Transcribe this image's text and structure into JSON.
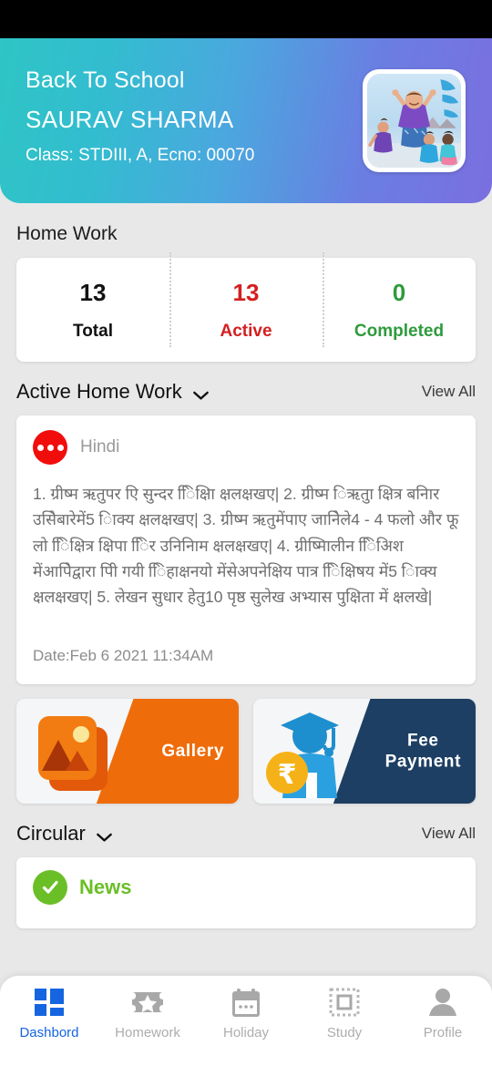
{
  "header": {
    "greeting": "Back To School",
    "student_name": "SAURAV  SHARMA",
    "class_info": "Class: STDIII, A, Ecno: 00070",
    "avatar_alt": "student-photo",
    "gradient_start": "#2ec5c5",
    "gradient_end": "#7a6fe0"
  },
  "homework_section": {
    "title": "Home Work",
    "stats": [
      {
        "value": "13",
        "label": "Total",
        "color": "#111111"
      },
      {
        "value": "13",
        "label": "Active",
        "color": "#d32020"
      },
      {
        "value": "0",
        "label": "Completed",
        "color": "#2e9b3c"
      }
    ]
  },
  "active_homework": {
    "title": "Active Home Work",
    "view_all": "View All",
    "card": {
      "subject": "Hindi",
      "body": "1. ग्रीष्म ऋतुपर एि सुन्दर ि‍िक्षिा क्षलक्षखए| 2. ग्रीष्म ि‍ऋतु‍ा क्षित्र बनिार उसिेबारेमें5 ि‍ाक्य क्षलक्षखए| 3. ग्रीष्म ऋतुमेंपाए जानिेले4 - 4 फलो और फू लो ि‍िक्षित्र क्षिपा ि‍ि‍र उनिनिाम क्षलक्षखए| 4. ग्रीष्मिालीन िि‍अिश मेंआपिेद्वारा पिी गयी ि‍िहाक्षनयो मेंसेअपनेक्षिय पात्र ि‍िक्षिषय में5 ि‍ाक्य क्षलक्षखए| 5. लेखन सुधार हेतु10 पृष्ठ सुलेख अभ्यास पुक्षिता में क्षलखे|",
      "date": "Date:Feb  6 2021 11:34AM"
    }
  },
  "tiles": [
    {
      "label": "Gallery",
      "accent": "#ef6c0a",
      "icon": "photo-gallery-icon"
    },
    {
      "label": "Fee\nPayment",
      "accent": "#1d3f63",
      "icon": "graduate-rupee-icon"
    }
  ],
  "circular_section": {
    "title": "Circular",
    "view_all": "View All",
    "items": [
      {
        "title": "News",
        "status_icon": "check-circle-icon",
        "color": "#6abf26"
      }
    ]
  },
  "bottom_nav": {
    "active_color": "#1565e0",
    "inactive_color": "#adadad",
    "items": [
      {
        "label": "Dashbord",
        "icon": "grid-dashboard-icon",
        "active": true
      },
      {
        "label": "Homework",
        "icon": "star-ticket-icon",
        "active": false
      },
      {
        "label": "Holiday",
        "icon": "calendar-icon",
        "active": false
      },
      {
        "label": "Study",
        "icon": "dashed-square-icon",
        "active": false
      },
      {
        "label": "Profile",
        "icon": "person-icon",
        "active": false
      }
    ]
  }
}
